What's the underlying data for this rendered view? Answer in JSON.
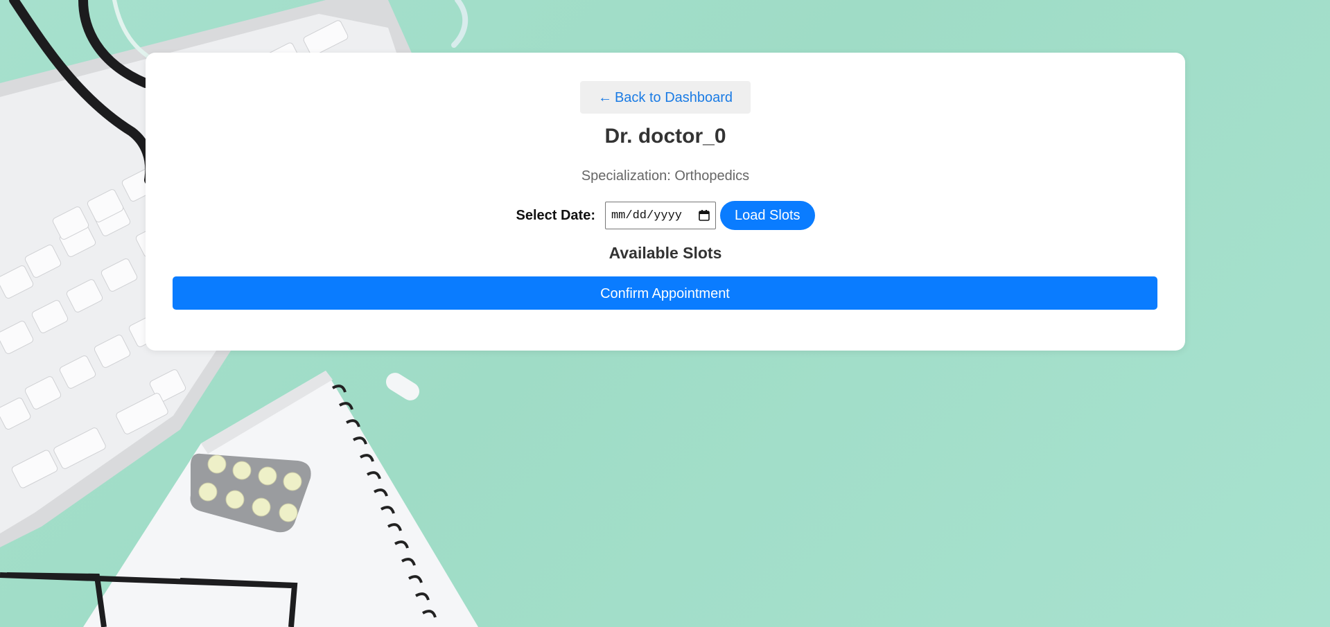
{
  "colors": {
    "background": "#a6e0cd",
    "card": "#ffffff",
    "accent": "#0a7cff",
    "link": "#1a7be4",
    "heading": "#333333",
    "muted": "#666666"
  },
  "header": {
    "back_arrow": "←",
    "back_label": "Back to Dashboard"
  },
  "doctor": {
    "name": "Dr. doctor_0",
    "specialization": "Specialization: Orthopedics"
  },
  "date_picker": {
    "label": "Select Date:",
    "placeholder": "mm/dd/yyyy",
    "icon": "calendar-icon"
  },
  "actions": {
    "load_slots_label": "Load Slots",
    "confirm_label": "Confirm Appointment"
  },
  "slots": {
    "heading": "Available Slots",
    "items": []
  }
}
